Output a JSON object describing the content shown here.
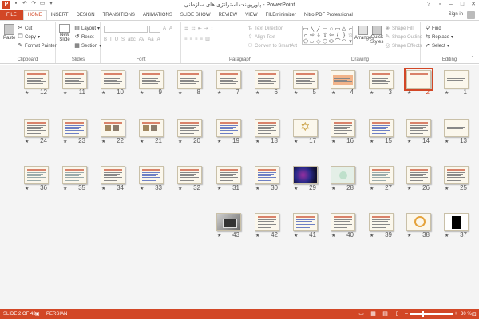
{
  "window": {
    "title": "پاورپوینت استراتژی های سازمانی - PowerPoint",
    "app_icon": "P",
    "sign_in": "Sign in"
  },
  "tabs": [
    "FILE",
    "HOME",
    "INSERT",
    "DESIGN",
    "TRANSITIONS",
    "ANIMATIONS",
    "SLIDE SHOW",
    "REVIEW",
    "VIEW",
    "FILEminimizer",
    "Nitro PDF Professional"
  ],
  "active_tab": "HOME",
  "ribbon": {
    "clipboard": {
      "paste": "Paste",
      "cut": "Cut",
      "copy": "Copy",
      "format_painter": "Format Painter",
      "label": "Clipboard"
    },
    "slides": {
      "new_slide": "New",
      "new_slide2": "Slide",
      "layout": "Layout",
      "reset": "Reset",
      "section": "Section",
      "label": "Slides"
    },
    "font": {
      "label": "Font",
      "buttons": [
        "B",
        "I",
        "U",
        "S",
        "abc",
        "AV",
        "Aa",
        "A"
      ]
    },
    "paragraph": {
      "text_direction": "Text Direction",
      "align_text": "Align Text",
      "convert_smartart": "Convert to SmartArt",
      "label": "Paragraph"
    },
    "drawing": {
      "arrange": "Arrange",
      "quick_styles": "Quick",
      "quick_styles2": "Styles",
      "shape_fill": "Shape Fill",
      "shape_outline": "Shape Outline",
      "shape_effects": "Shape Effects",
      "label": "Drawing"
    },
    "editing": {
      "find": "Find",
      "replace": "Replace",
      "select": "Select",
      "label": "Editing"
    }
  },
  "slides": [
    {
      "n": "1",
      "style": "title"
    },
    {
      "n": "2",
      "style": "plain",
      "selected": true
    },
    {
      "n": "3",
      "style": "text"
    },
    {
      "n": "4",
      "style": "orange"
    },
    {
      "n": "5",
      "style": "text"
    },
    {
      "n": "6",
      "style": "text"
    },
    {
      "n": "7",
      "style": "text"
    },
    {
      "n": "8",
      "style": "text"
    },
    {
      "n": "9",
      "style": "text"
    },
    {
      "n": "10",
      "style": "text"
    },
    {
      "n": "11",
      "style": "text"
    },
    {
      "n": "12",
      "style": "text"
    },
    {
      "n": "13",
      "style": "title"
    },
    {
      "n": "14",
      "style": "text"
    },
    {
      "n": "15",
      "style": "blue"
    },
    {
      "n": "16",
      "style": "text"
    },
    {
      "n": "17",
      "style": "star"
    },
    {
      "n": "18",
      "style": "text"
    },
    {
      "n": "19",
      "style": "blue"
    },
    {
      "n": "20",
      "style": "text"
    },
    {
      "n": "21",
      "style": "pics"
    },
    {
      "n": "22",
      "style": "pics"
    },
    {
      "n": "23",
      "style": "blue"
    },
    {
      "n": "24",
      "style": "text"
    },
    {
      "n": "25",
      "style": "text"
    },
    {
      "n": "26",
      "style": "text"
    },
    {
      "n": "27",
      "style": "grid"
    },
    {
      "n": "28",
      "style": "cyan"
    },
    {
      "n": "29",
      "style": "navy"
    },
    {
      "n": "30",
      "style": "blue"
    },
    {
      "n": "31",
      "style": "text"
    },
    {
      "n": "32",
      "style": "text"
    },
    {
      "n": "33",
      "style": "blue"
    },
    {
      "n": "34",
      "style": "text"
    },
    {
      "n": "35",
      "style": "grid"
    },
    {
      "n": "36",
      "style": "grid"
    },
    {
      "n": "37",
      "style": "black"
    },
    {
      "n": "38",
      "style": "circle"
    },
    {
      "n": "39",
      "style": "text"
    },
    {
      "n": "40",
      "style": "text"
    },
    {
      "n": "41",
      "style": "blue"
    },
    {
      "n": "42",
      "style": "text"
    },
    {
      "n": "43",
      "style": "laptop"
    }
  ],
  "statusbar": {
    "slide_counter": "SLIDE 2 OF 43",
    "language": "PERSIAN",
    "zoom": "30 %",
    "zoom_fraction": 0.3
  },
  "colors": {
    "accent": "#d24726",
    "sorter_bg": "#f4f4f4"
  }
}
